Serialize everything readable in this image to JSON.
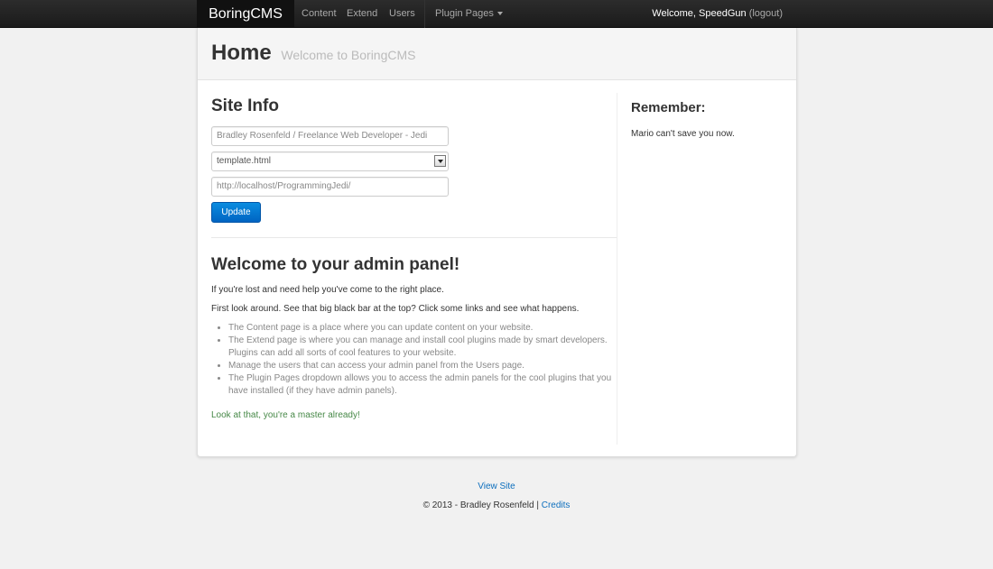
{
  "navbar": {
    "brand": "BoringCMS",
    "items": [
      {
        "label": "Content"
      },
      {
        "label": "Extend"
      },
      {
        "label": "Users"
      }
    ],
    "dropdown_label": "Plugin Pages",
    "welcome_text": "Welcome, SpeedGun",
    "logout_label": "(logout)"
  },
  "header": {
    "title": "Home",
    "subtitle": "Welcome to BoringCMS"
  },
  "site_info": {
    "heading": "Site Info",
    "site_name_value": "Bradley Rosenfeld / Freelance Web Developer - Jedi",
    "template_value": "template.html",
    "site_url_value": "http://localhost/ProgrammingJedi/",
    "update_label": "Update"
  },
  "welcome": {
    "heading": "Welcome to your admin panel!",
    "intro": "If you're lost and need help you've come to the right place.",
    "first_look": "First look around. See that big black bar at the top? Click some links and see what happens.",
    "tips": [
      "The Content page is a place where you can update content on your website.",
      "The Extend page is where you can manage and install cool plugins made by smart developers. Plugins can add all sorts of cool features to your website.",
      "Manage the users that can access your admin panel from the Users page.",
      "The Plugin Pages dropdown allows you to access the admin panels for the cool plugins that you have installed (if they have admin panels)."
    ],
    "closing": "Look at that, you're a master already!"
  },
  "sidebar": {
    "title": "Remember:",
    "text": "Mario can't save you now."
  },
  "footer": {
    "view_site_label": "View Site",
    "copyright": "© 2013 - Bradley Rosenfeld |",
    "credits_label": "Credits"
  },
  "colors": {
    "navbar": "#1b1b1b",
    "primary_button": "#0074cc",
    "link": "#0c6ebd",
    "success_text": "#468847",
    "background": "#f1f1f1"
  }
}
